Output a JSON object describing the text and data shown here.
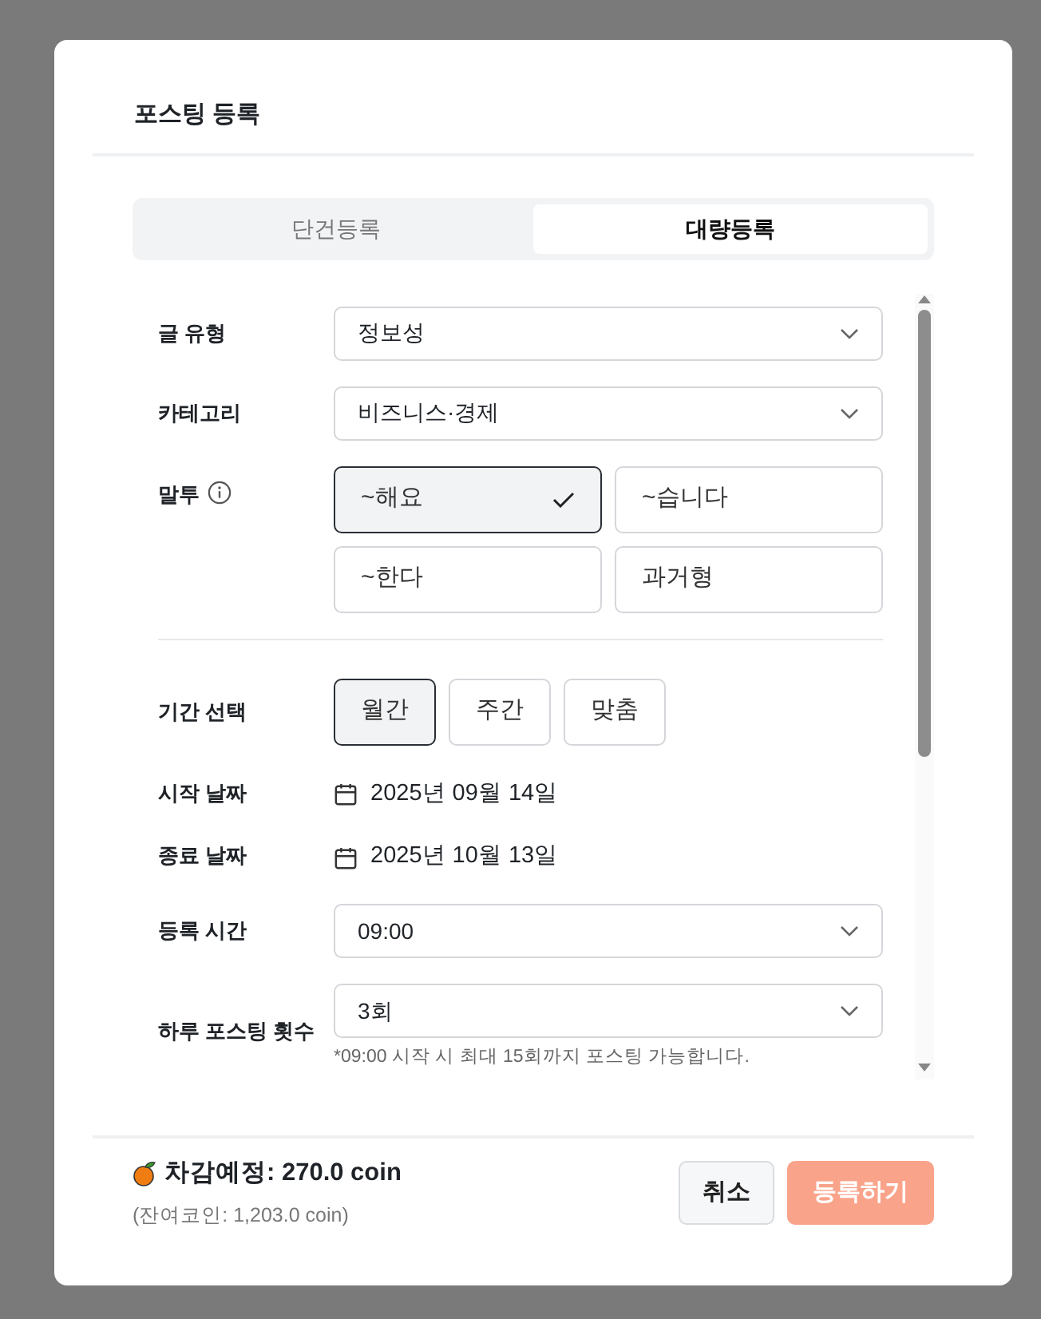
{
  "dialog": {
    "title": "포스팅 등록"
  },
  "tabs": [
    {
      "label": "단건등록",
      "selected": false
    },
    {
      "label": "대량등록",
      "selected": true
    }
  ],
  "fields": [
    {
      "kind": "select",
      "label": "글 유형",
      "value": "정보성"
    },
    {
      "kind": "select",
      "label": "카테고리",
      "value": "비즈니스·경제"
    },
    {
      "kind": "choices",
      "label": "말투",
      "info_icon": true,
      "options": [
        {
          "label": "~해요",
          "selected": true
        },
        {
          "label": "~습니다",
          "selected": false
        },
        {
          "label": "~한다",
          "selected": false
        },
        {
          "label": "과거형",
          "selected": false
        }
      ]
    },
    {
      "kind": "divider"
    },
    {
      "kind": "segmented",
      "label": "기간 선택",
      "options": [
        {
          "label": "월간",
          "selected": true
        },
        {
          "label": "주간",
          "selected": false
        },
        {
          "label": "맞춤",
          "selected": false
        }
      ]
    },
    {
      "kind": "date",
      "label": "시작 날짜",
      "value": "2025년 09월 14일"
    },
    {
      "kind": "date",
      "label": "종료 날짜",
      "value": "2025년 10월 13일"
    },
    {
      "kind": "select",
      "label": "등록 시간",
      "value": "09:00"
    },
    {
      "kind": "select",
      "label": "하루 포스팅 횟수",
      "value": "3회",
      "note": "*09:00 시작 시 최대 15회까지 포스팅 가능합니다."
    }
  ],
  "footer": {
    "cost": "차감예정: 270.0 coin",
    "balance": "(잔여코인: 1,203.0 coin)",
    "buttons": [
      {
        "kind": "cancel",
        "label": "취소",
        "disabled": false
      },
      {
        "kind": "submit",
        "label": "등록하기",
        "disabled": true
      }
    ]
  }
}
